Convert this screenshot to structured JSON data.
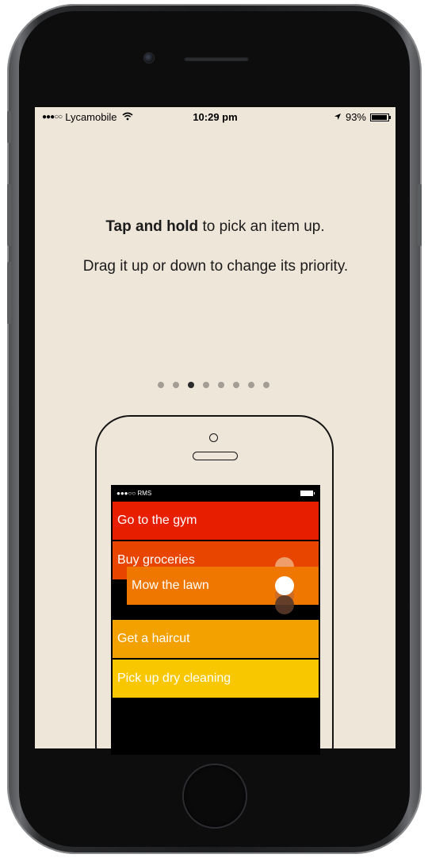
{
  "status_bar": {
    "signal": "●●●○○",
    "carrier": "Lycamobile",
    "wifi_icon": "wifi-icon",
    "time": "10:29 pm",
    "location_icon": "location-arrow-icon",
    "battery_percent": "93%",
    "battery_level": 0.93
  },
  "instructions": {
    "line1_bold": "Tap and hold",
    "line1_rest": " to pick an item up.",
    "line2": "Drag it up or down to change its priority."
  },
  "pager": {
    "total": 8,
    "active_index": 2
  },
  "illustration": {
    "mini_status_text": "●●●○○ RMS",
    "tasks": [
      {
        "label": "Go to the gym",
        "color": "#e81e00"
      },
      {
        "label": "Buy groceries",
        "color": "#e84500"
      },
      {
        "label": "Get a haircut",
        "color": "#f3a100"
      },
      {
        "label": "Pick up dry cleaning",
        "color": "#f8c700"
      }
    ],
    "dragged_task": {
      "label": "Mow the lawn",
      "color": "#ef7700"
    }
  }
}
